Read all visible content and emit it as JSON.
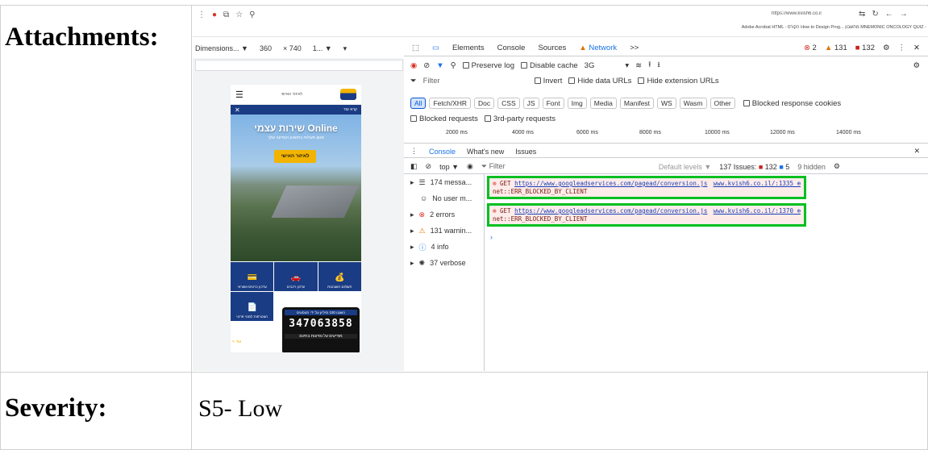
{
  "labels": {
    "attachments": "Attachments:",
    "severity": "Severity:",
    "severity_value": "S5- Low"
  },
  "browser": {
    "url": "https://www.kvish6.co.il",
    "bookmarks": "Adobe Acrobat  HTML - הקורס  How to Design Prog...  מחשבון  MNEMONIC  ONCOLOGY QUIZ -"
  },
  "device": {
    "dims_label": "Dimensions... ▼",
    "width": "360",
    "times": "× 740",
    "zoom": "1... ▼"
  },
  "phone": {
    "header_link": "לאיזור האישי",
    "sub_text": "קרא עוד",
    "hero_title": "שירות עצמי Online",
    "hero_sub": "מגוון פעולות בחשבון הנסיעה שלך",
    "hero_button": "לאיזור האישי",
    "tiles": [
      {
        "icon": "💳",
        "label": "עדכון כרטיס אשראי"
      },
      {
        "icon": "🚗",
        "label": "עדכון רכבים"
      },
      {
        "icon": "💰",
        "label": "תשלום חשבונות"
      },
      {
        "icon": "📄",
        "label": "הצטרפות למנוי פרטי"
      },
      {
        "icon": "",
        "label": ""
      },
      {
        "icon": "",
        "label": ""
      }
    ],
    "more": "< עוד",
    "popup_head": "השגנו 100 מיליון על ידי הנוסעים",
    "popup_clock": "347063858",
    "popup_foot": "מודיעים על נסיעות בחינם"
  },
  "devtools": {
    "tabs": [
      "Elements",
      "Console",
      "Sources",
      "Network",
      ">>"
    ],
    "active_tab": "Network",
    "errors": "2",
    "warnings": "131",
    "issues": "132",
    "toolbar": {
      "preserve_log": "Preserve log",
      "disable_cache": "Disable cache",
      "throttle": "3G"
    },
    "filter_placeholder": "Filter",
    "invert": "Invert",
    "hide_data": "Hide data URLs",
    "hide_ext": "Hide extension URLs",
    "chips": [
      "All",
      "Fetch/XHR",
      "Doc",
      "CSS",
      "JS",
      "Font",
      "Img",
      "Media",
      "Manifest",
      "WS",
      "Wasm",
      "Other"
    ],
    "blocked_cookies": "Blocked response cookies",
    "blocked_requests": "Blocked requests",
    "third_party": "3rd-party requests",
    "timeline": [
      "2000 ms",
      "4000 ms",
      "6000 ms",
      "8000 ms",
      "10000 ms",
      "12000 ms",
      "14000 ms"
    ],
    "console_tabs": [
      "Console",
      "What's new",
      "Issues"
    ],
    "context": "top ▼",
    "console_filter": "Filter",
    "levels": "Default levels ▼",
    "issues_summary": "137 Issues:",
    "issues_a": "132",
    "issues_b": "5",
    "hidden": "9 hidden",
    "side": [
      {
        "icon": "☰",
        "label": "174 messa..."
      },
      {
        "icon": "☺",
        "label": "No user m..."
      },
      {
        "icon": "⊗",
        "label": "2 errors"
      },
      {
        "icon": "⚠",
        "label": "131 warnin..."
      },
      {
        "icon": "ⓘ",
        "label": "4 info"
      },
      {
        "icon": "✺",
        "label": "37 verbose"
      }
    ],
    "messages": [
      {
        "method": "GET",
        "url": "https://www.googleadservices.com/pagead/conversion.js",
        "error": "net::ERR_BLOCKED_BY_CLIENT",
        "source": "www.kvish6.co.il/:1335"
      },
      {
        "method": "GET",
        "url": "https://www.googleadservices.com/pagead/conversion.js",
        "error": "net::ERR_BLOCKED_BY_CLIENT",
        "source": "www.kvish6.co.il/:1370"
      }
    ]
  }
}
